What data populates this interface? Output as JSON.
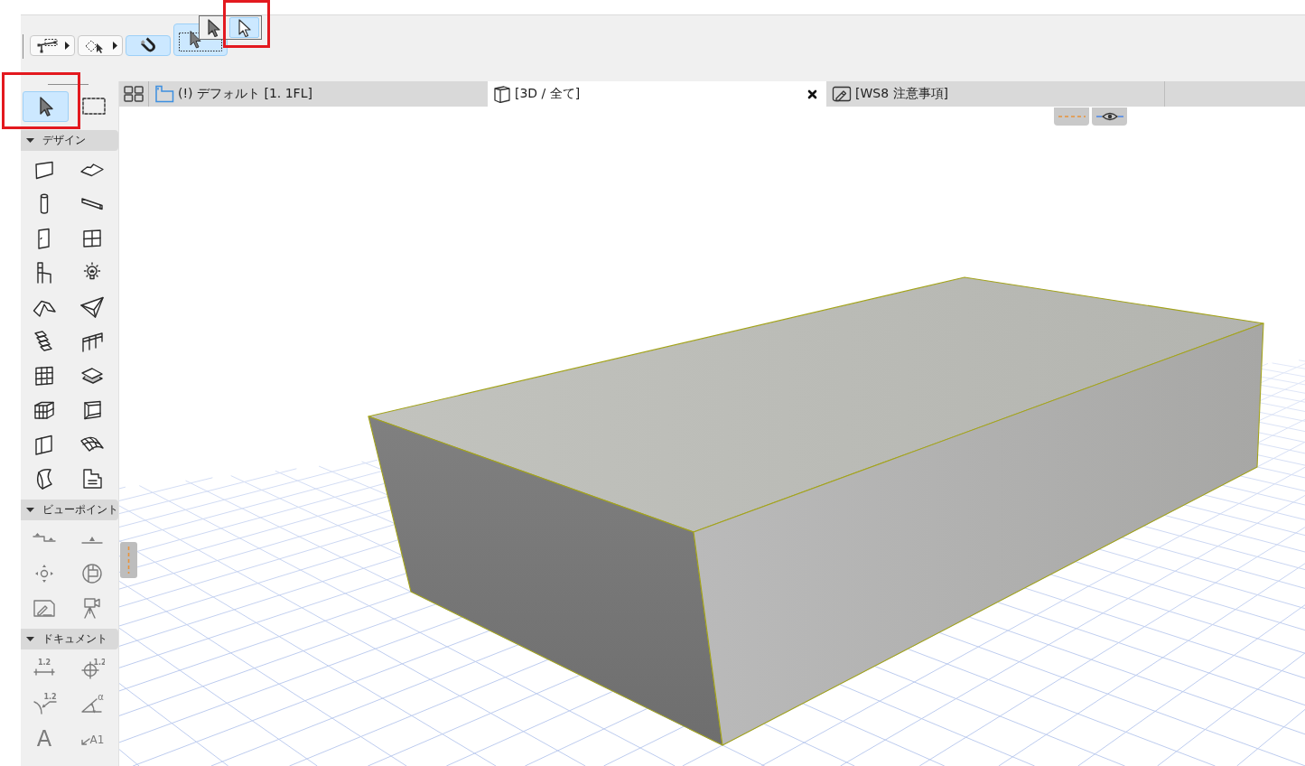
{
  "toolbar": {
    "tools": [
      {
        "kind": "line-marquee",
        "selected": false,
        "has_menu": true
      },
      {
        "kind": "shape-marquee",
        "selected": false,
        "has_menu": true
      },
      {
        "kind": "magnet",
        "selected": true,
        "has_menu": false
      },
      {
        "kind": "arrow-marquee",
        "selected": true,
        "has_menu": false
      }
    ],
    "flyout": {
      "options": [
        {
          "kind": "arrow-filled",
          "selected": false,
          "highlighted": false
        },
        {
          "kind": "arrow-outline",
          "selected": true,
          "highlighted": true
        }
      ]
    }
  },
  "toolbox": {
    "top": [
      {
        "kind": "arrow",
        "selected": true,
        "highlighted": true
      },
      {
        "kind": "marquee",
        "selected": false,
        "highlighted": false
      }
    ],
    "sections": [
      {
        "title": "デザイン",
        "expanded": true,
        "tools": [
          {
            "kind": "wall",
            "selected": false
          },
          {
            "kind": "slab",
            "selected": false
          },
          {
            "kind": "column",
            "selected": false
          },
          {
            "kind": "beam",
            "selected": false
          },
          {
            "kind": "door",
            "selected": false
          },
          {
            "kind": "window",
            "selected": false
          },
          {
            "kind": "object",
            "selected": false
          },
          {
            "kind": "lamp",
            "selected": false
          },
          {
            "kind": "roof",
            "selected": false
          },
          {
            "kind": "shell",
            "selected": false
          },
          {
            "kind": "stair",
            "selected": false
          },
          {
            "kind": "railing",
            "selected": false
          },
          {
            "kind": "curtain-wall",
            "selected": false
          },
          {
            "kind": "skylight",
            "selected": false
          },
          {
            "kind": "morph",
            "selected": false
          },
          {
            "kind": "opening",
            "selected": false
          },
          {
            "kind": "panel",
            "selected": false
          },
          {
            "kind": "mesh",
            "selected": false
          },
          {
            "kind": "curved",
            "selected": false
          },
          {
            "kind": "zone",
            "selected": false
          }
        ]
      },
      {
        "title": "ビューポイント",
        "expanded": true,
        "tools": [
          {
            "kind": "section",
            "selected": false
          },
          {
            "kind": "elevation",
            "selected": false
          },
          {
            "kind": "orbit",
            "selected": false
          },
          {
            "kind": "interior",
            "selected": false
          },
          {
            "kind": "worksheet",
            "selected": false
          },
          {
            "kind": "camera",
            "selected": false
          }
        ]
      },
      {
        "title": "ドキュメント",
        "expanded": true,
        "tools": [
          {
            "kind": "dimension",
            "mark": "1.2",
            "selected": false
          },
          {
            "kind": "level",
            "mark": "1.2",
            "selected": false
          },
          {
            "kind": "radial",
            "mark": "1.2",
            "selected": false
          },
          {
            "kind": "angle",
            "mark": "α",
            "selected": false
          },
          {
            "kind": "text",
            "mark": "A",
            "selected": false
          },
          {
            "kind": "label",
            "mark": "A1",
            "selected": false
          }
        ]
      }
    ]
  },
  "tabs": [
    {
      "kind": "plan",
      "label": "(!) デフォルト [1. 1FL]",
      "selected": false
    },
    {
      "kind": "model",
      "label": "[3D / 全て]",
      "selected": true
    },
    {
      "kind": "worksheet",
      "label": "[WS8 注意事項]",
      "selected": false
    }
  ],
  "view_buttons": [
    {
      "kind": "line-style"
    },
    {
      "kind": "eye"
    }
  ]
}
